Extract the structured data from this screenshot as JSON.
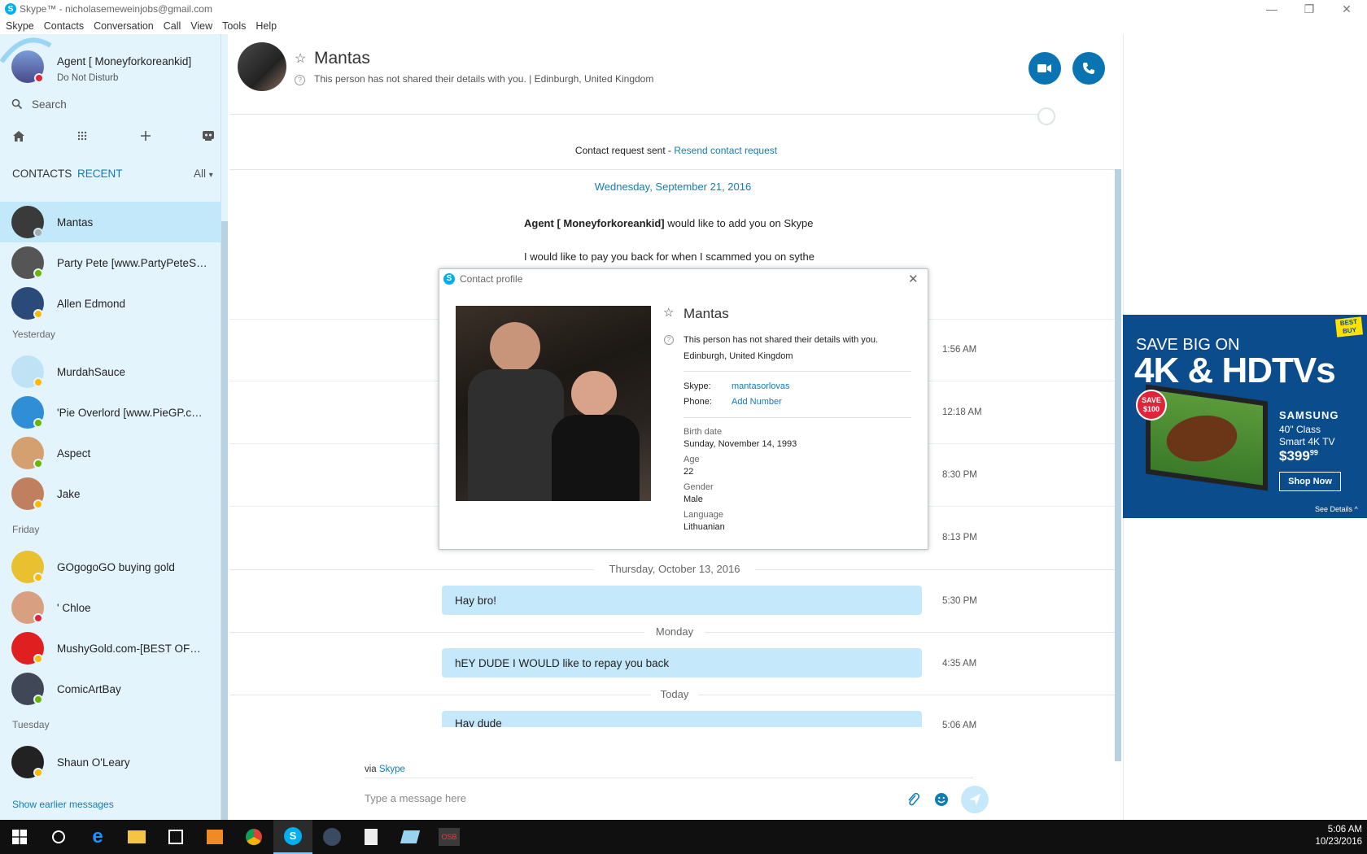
{
  "window": {
    "title": "Skype™ - nicholasemeweinjobs@gmail.com",
    "minimize": "—",
    "restore": "❐",
    "close": "✕"
  },
  "menu": [
    "Skype",
    "Contacts",
    "Conversation",
    "Call",
    "View",
    "Tools",
    "Help"
  ],
  "profile": {
    "name": "Agent [ Moneyforkoreankid]",
    "status": "Do Not Disturb"
  },
  "search": {
    "placeholder": "Search"
  },
  "tabs": {
    "contacts": "CONTACTS",
    "recent": "RECENT",
    "filter": "All"
  },
  "contacts": [
    {
      "name": "Mantas",
      "status": "grey",
      "avatar": "#3a3a3a"
    },
    {
      "name": "Party Pete [www.PartyPeteSho...",
      "status": "green",
      "avatar": "#555"
    },
    {
      "name": "Allen Edmond",
      "status": "yellow",
      "avatar": "#2a4a7a"
    }
  ],
  "section_yesterday": "Yesterday",
  "contacts_yesterday": [
    {
      "name": "MurdahSauce",
      "status": "yellow",
      "avatar": "#bfe3f5"
    },
    {
      "name": "'Pie Overlord [www.PieGP.com...",
      "status": "green",
      "avatar": "#2f8ed6"
    },
    {
      "name": "Aspect",
      "status": "green",
      "avatar": "#d5a070"
    },
    {
      "name": "Jake",
      "status": "yellow",
      "avatar": "#c08060"
    }
  ],
  "section_friday": "Friday",
  "contacts_friday": [
    {
      "name": "GOgogoGO buying gold",
      "status": "yellow",
      "avatar": "#e8c030"
    },
    {
      "name": "' Chloe",
      "status": "red",
      "avatar": "#d8a080"
    },
    {
      "name": "MushyGold.com-[BEST OFFER...",
      "status": "yellow",
      "avatar": "#e02020"
    },
    {
      "name": "ComicArtBay",
      "status": "green",
      "avatar": "#404858"
    }
  ],
  "section_tuesday": "Tuesday",
  "contacts_tuesday": [
    {
      "name": "Shaun O'Leary",
      "status": "yellow",
      "avatar": "#222"
    }
  ],
  "show_earlier": "Show earlier messages",
  "chat": {
    "name": "Mantas",
    "info": "This person has not shared their details with you.  |  Edinburgh, United Kingdom",
    "request_sent": "Contact request sent - ",
    "resend": "Resend contact request",
    "date1": "Wednesday, September 21, 2016",
    "add_name": "Agent [ Moneyforkoreankid]",
    "add_text": " would like to add you on Skype",
    "request_msg": "I would like to pay you back for when I scammed you on sythe",
    "times_hidden": [
      "1:56 AM",
      "12:18 AM",
      "8:30 PM",
      "8:13 PM"
    ],
    "date2": "Thursday, October 13, 2016",
    "msg1": "Hay bro!",
    "time1": "5:30 PM",
    "date3": "Monday",
    "msg2": "hEY DUDE I WOULD like to repay you back",
    "time2": "4:35 AM",
    "date4": "Today",
    "msg3": "Hay dude",
    "time3": "5:06 AM",
    "via": "via ",
    "via_link": "Skype",
    "input_placeholder": "Type a message here"
  },
  "modal": {
    "title": "Contact profile",
    "name": "Mantas",
    "not_shared": "This person has not shared their details with you.",
    "location": "Edinburgh, United Kingdom",
    "skype_label": "Skype:",
    "skype_val": "mantasorlovas",
    "phone_label": "Phone:",
    "phone_val": "Add Number",
    "birth_label": "Birth date",
    "birth_val": "Sunday, November 14, 1993",
    "age_label": "Age",
    "age_val": "22",
    "gender_label": "Gender",
    "gender_val": "Male",
    "lang_label": "Language",
    "lang_val": "Lithuanian"
  },
  "ad": {
    "line1": "SAVE BIG ON",
    "line2": "4K & HDTVs",
    "badge_top": "SAVE",
    "badge_amt": "$100",
    "brand": "SAMSUNG",
    "desc1": "40\" Class",
    "desc2": "Smart 4K TV",
    "price": "$399",
    "price_cents": "99",
    "shop": "Shop Now",
    "see": "See Details ^",
    "logo": "BEST BUY"
  },
  "taskbar": {
    "time": "5:06 AM",
    "date": "10/23/2016",
    "osb": "OSB"
  }
}
